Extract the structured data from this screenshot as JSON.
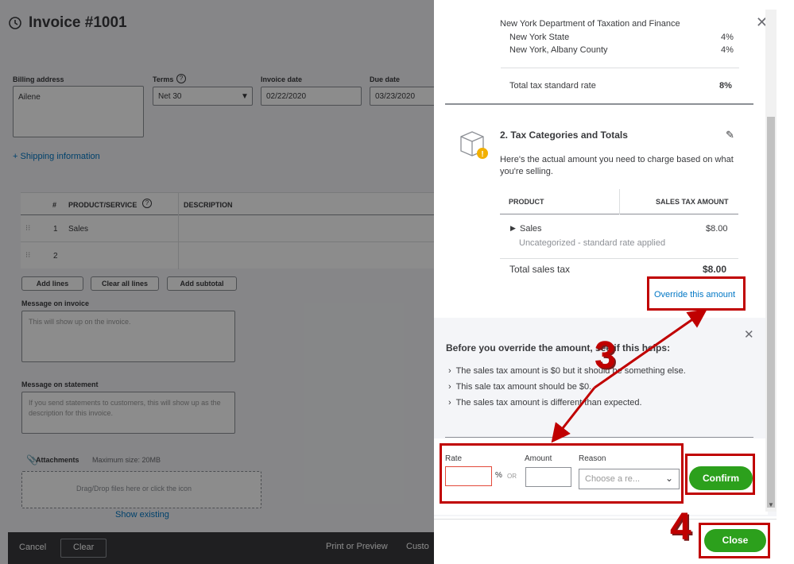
{
  "invoice": {
    "title": "Invoice #1001",
    "billing_address_label": "Billing address",
    "billing_address_value": "Ailene",
    "terms_label": "Terms",
    "terms_value": "Net 30",
    "invoice_date_label": "Invoice date",
    "invoice_date_value": "02/22/2020",
    "due_date_label": "Due date",
    "due_date_value": "03/23/2020",
    "shipping_link": "+ Shipping information",
    "table_headers": {
      "num": "#",
      "product": "PRODUCT/SERVICE",
      "description": "DESCRIPTION"
    },
    "rows": [
      {
        "num": "1",
        "product": "Sales"
      },
      {
        "num": "2",
        "product": ""
      }
    ],
    "add_lines": "Add lines",
    "clear_all_lines": "Clear all lines",
    "add_subtotal": "Add subtotal",
    "message_invoice_label": "Message on invoice",
    "message_invoice_placeholder": "This will show up on the invoice.",
    "message_statement_label": "Message on statement",
    "message_statement_placeholder": "If you send statements to customers, this will show up as the description for this invoice.",
    "attachments_label": "Attachments",
    "attachments_max": "Maximum size: 20MB",
    "dropzone_text": "Drag/Drop files here or click the icon",
    "show_existing": "Show existing",
    "footer": {
      "cancel": "Cancel",
      "clear": "Clear",
      "print_preview": "Print or Preview",
      "customize": "Custo"
    }
  },
  "panel": {
    "agency": "New York Department of Taxation and Finance",
    "rates": [
      {
        "name": "New York State",
        "rate": "4%"
      },
      {
        "name": "New York, Albany County",
        "rate": "4%"
      }
    ],
    "total_rate_label": "Total tax standard rate",
    "total_rate_value": "8%",
    "section_title": "2. Tax Categories and Totals",
    "section_desc": "Here's the actual amount you need to charge based on what you're selling.",
    "col_product": "PRODUCT",
    "col_amount": "SALES TAX AMOUNT",
    "row_name": "Sales",
    "row_amount": "$8.00",
    "row_sub": "Uncategorized - standard rate applied",
    "total_label": "Total sales tax",
    "total_value": "$8.00",
    "override_link": "Override this amount",
    "help_title": "Before you override the amount, see if this helps:",
    "help_items": [
      "The sales tax amount is $0 but it should be something else.",
      "This sale tax amount should be $0.",
      "The sales tax amount is different than expected."
    ],
    "rate_label": "Rate",
    "percent": "%",
    "or": "OR",
    "amount_label": "Amount",
    "reason_label": "Reason",
    "reason_placeholder": "Choose a re...",
    "confirm": "Confirm",
    "close": "Close"
  },
  "annotations": {
    "step3": "3",
    "step4": "4"
  },
  "colors": {
    "green": "#2ca01c",
    "red": "#c00000",
    "link": "#0077c5"
  }
}
